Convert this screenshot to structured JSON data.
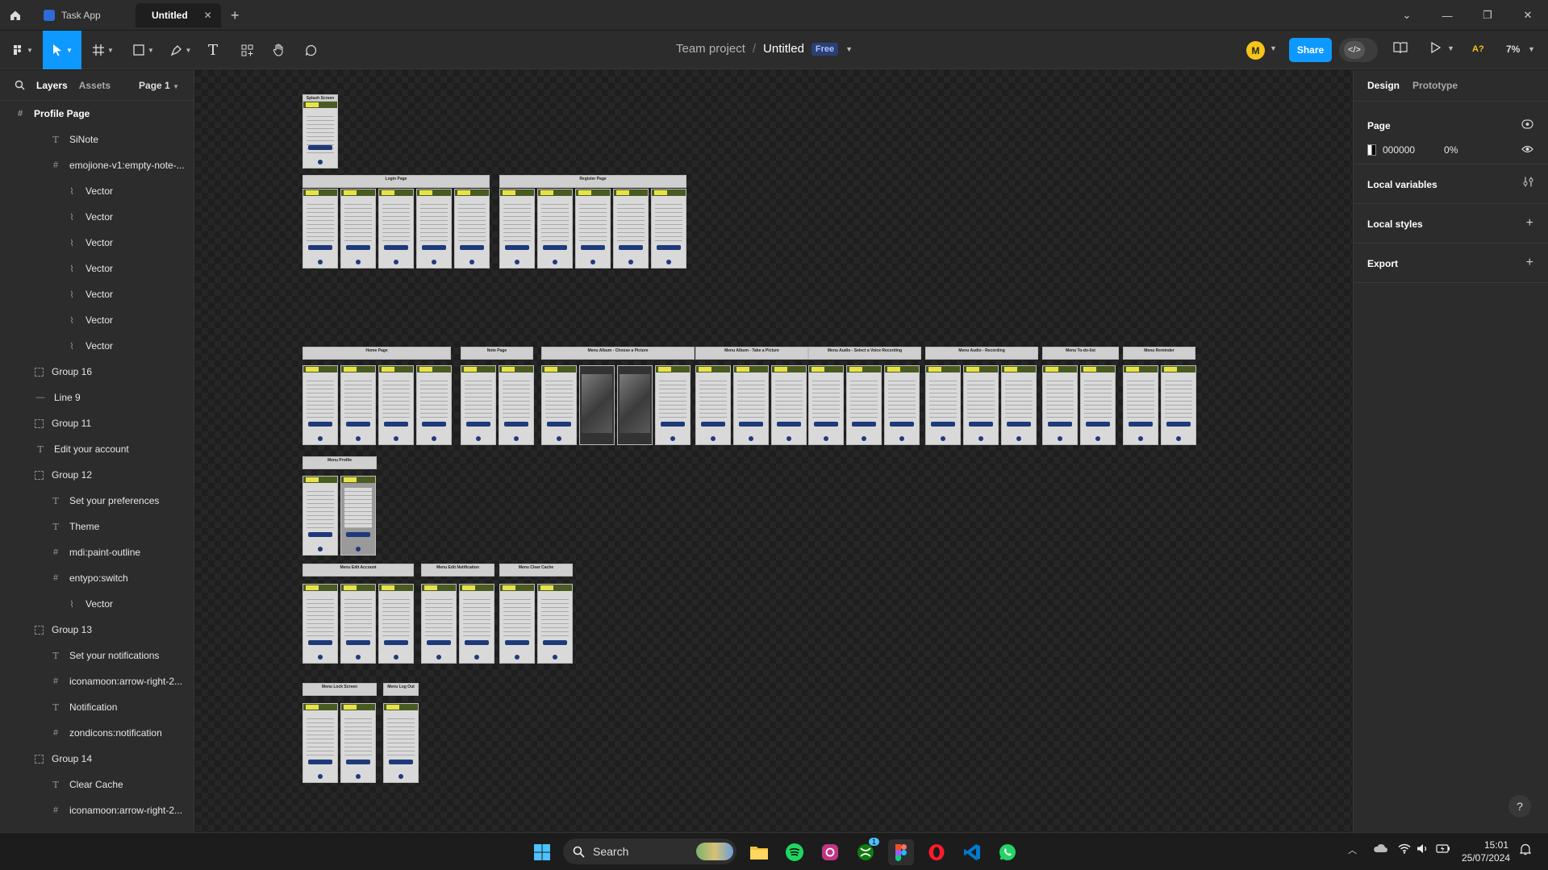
{
  "titlebar": {
    "tabs": [
      {
        "label": "Task App"
      },
      {
        "label": "Untitled",
        "close": "✕"
      }
    ],
    "add_tab": "+"
  },
  "toolbar": {
    "breadcrumb_project": "Team project",
    "breadcrumb_sep": "/",
    "file_name": "Untitled",
    "plan_badge": "Free",
    "avatar_initial": "M",
    "share_label": "Share",
    "ai_label": "A?",
    "zoom": "7%"
  },
  "left_panel": {
    "tab_layers": "Layers",
    "tab_assets": "Assets",
    "page_selector": "Page 1",
    "layers": [
      {
        "label": "Profile Page",
        "kind": "frame",
        "indent": 0
      },
      {
        "label": "SiNote",
        "kind": "text",
        "indent": 2
      },
      {
        "label": "emojione-v1:empty-note-...",
        "kind": "frame",
        "indent": 2
      },
      {
        "label": "Vector",
        "kind": "vector",
        "indent": 3
      },
      {
        "label": "Vector",
        "kind": "vector",
        "indent": 3
      },
      {
        "label": "Vector",
        "kind": "vector",
        "indent": 3
      },
      {
        "label": "Vector",
        "kind": "vector",
        "indent": 3
      },
      {
        "label": "Vector",
        "kind": "vector",
        "indent": 3
      },
      {
        "label": "Vector",
        "kind": "vector",
        "indent": 3
      },
      {
        "label": "Vector",
        "kind": "vector",
        "indent": 3
      },
      {
        "label": "Group 16",
        "kind": "group",
        "indent": 1
      },
      {
        "label": "Line 9",
        "kind": "line",
        "indent": 1
      },
      {
        "label": "Group 11",
        "kind": "group",
        "indent": 1
      },
      {
        "label": "Edit your account",
        "kind": "text",
        "indent": 1
      },
      {
        "label": "Group 12",
        "kind": "group",
        "indent": 1
      },
      {
        "label": "Set your preferences",
        "kind": "text",
        "indent": 2
      },
      {
        "label": "Theme",
        "kind": "text",
        "indent": 2
      },
      {
        "label": "mdi:paint-outline",
        "kind": "frame",
        "indent": 2
      },
      {
        "label": "entypo:switch",
        "kind": "frame",
        "indent": 2
      },
      {
        "label": "Vector",
        "kind": "vector",
        "indent": 3
      },
      {
        "label": "Group 13",
        "kind": "group",
        "indent": 1
      },
      {
        "label": "Set your notifications",
        "kind": "text",
        "indent": 2
      },
      {
        "label": "iconamoon:arrow-right-2...",
        "kind": "frame",
        "indent": 2
      },
      {
        "label": "Notification",
        "kind": "text",
        "indent": 2
      },
      {
        "label": "zondicons:notification",
        "kind": "frame",
        "indent": 2
      },
      {
        "label": "Group 14",
        "kind": "group",
        "indent": 1
      },
      {
        "label": "Clear Cache",
        "kind": "text",
        "indent": 2
      },
      {
        "label": "iconamoon:arrow-right-2...",
        "kind": "frame",
        "indent": 2
      }
    ]
  },
  "canvas": {
    "section_labels": [
      "Splash Screen",
      "Login Page",
      "Register Page",
      "Home Page",
      "Note Page",
      "Menu Album - Choose a Picture",
      "Menu Album - Take a Picture",
      "Menu Audio - Select a Voice Recording",
      "Menu Audio - Recording",
      "Menu To-do-list",
      "Menu Reminder",
      "Menu Profile",
      "Menu Edit Account",
      "Menu Edit Notification",
      "Menu Clear Cache",
      "Menu Lock Screen",
      "Menu Log Out"
    ]
  },
  "right_panel": {
    "tab_design": "Design",
    "tab_prototype": "Prototype",
    "page_title": "Page",
    "page_color": "000000",
    "page_opacity": "0%",
    "local_variables": "Local variables",
    "local_styles": "Local styles",
    "export": "Export",
    "help": "?"
  },
  "taskbar": {
    "search_label": "Search",
    "time": "15:01",
    "date": "25/07/2024",
    "xbox_badge": "1"
  }
}
